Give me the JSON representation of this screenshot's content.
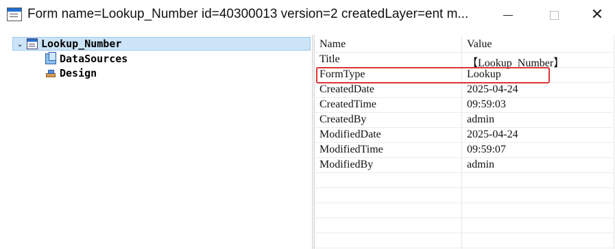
{
  "window": {
    "title": "Form name=Lookup_Number id=40300013 version=2 createdLayer=ent m...",
    "app_icon": "form-window-icon",
    "controls": {
      "minimize_icon": "minimize-icon",
      "maximize_icon": "maximize-icon",
      "close_icon": "close-icon",
      "close_glyph": "✕"
    }
  },
  "tree": {
    "expander_glyph": "⌄",
    "root": {
      "label": "Lookup_Number",
      "icon": "form-icon",
      "expanded": true
    },
    "children": [
      {
        "label": "DataSources",
        "icon": "datasources-icon"
      },
      {
        "label": "Design",
        "icon": "design-icon"
      }
    ]
  },
  "properties": {
    "columns": {
      "name": "Name",
      "value": "Value"
    },
    "rows": [
      {
        "name": "Title",
        "value": "【Lookup_Number】"
      },
      {
        "name": "FormType",
        "value": "Lookup"
      },
      {
        "name": "CreatedDate",
        "value": "2025-04-24"
      },
      {
        "name": "CreatedTime",
        "value": "09:59:03"
      },
      {
        "name": "CreatedBy",
        "value": "admin"
      },
      {
        "name": "ModifiedDate",
        "value": "2025-04-24"
      },
      {
        "name": "ModifiedTime",
        "value": "09:59:07"
      },
      {
        "name": "ModifiedBy",
        "value": "admin"
      }
    ],
    "highlighted_row": "FormType",
    "highlight_color": "#e03030"
  },
  "colors": {
    "selection_bg": "#cce4f7",
    "selection_border": "#99c9ef"
  }
}
